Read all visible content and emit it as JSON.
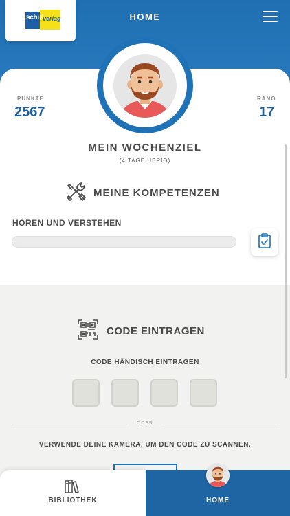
{
  "header": {
    "title": "HOME",
    "logo_text_left": "schul",
    "logo_text_right": "verlag",
    "colors": {
      "primary": "#1f72b5",
      "dark": "#1f5f9a",
      "logo_yellow": "#f4e11a"
    }
  },
  "stats": {
    "points_label": "PUNKTE",
    "points_value": "2567",
    "rank_label": "RANG",
    "rank_value": "17"
  },
  "goal": {
    "title": "MEIN WOCHENZIEL",
    "subtitle": "(4 TAGE ÜBRIG)"
  },
  "competences": {
    "title": "MEINE KOMPETENZEN",
    "icon": "tools-icon",
    "items": [
      {
        "label": "HÖREN UND VERSTEHEN",
        "progress": 0
      }
    ]
  },
  "code": {
    "title": "CODE EINTRAGEN",
    "icon": "qr-code-icon",
    "manual_label": "CODE HÄNDISCH EINTRAGEN",
    "fields": [
      "",
      "",
      "",
      ""
    ],
    "or_label": "ODER",
    "camera_text": "VERWENDE DEINE KAMERA, UM DEN CODE ZU SCANNEN."
  },
  "tabbar": {
    "tabs": [
      {
        "label": "BIBLIOTHEK",
        "icon": "books-icon",
        "active": false
      },
      {
        "label": "HOME",
        "icon": "avatar",
        "active": true
      }
    ]
  }
}
